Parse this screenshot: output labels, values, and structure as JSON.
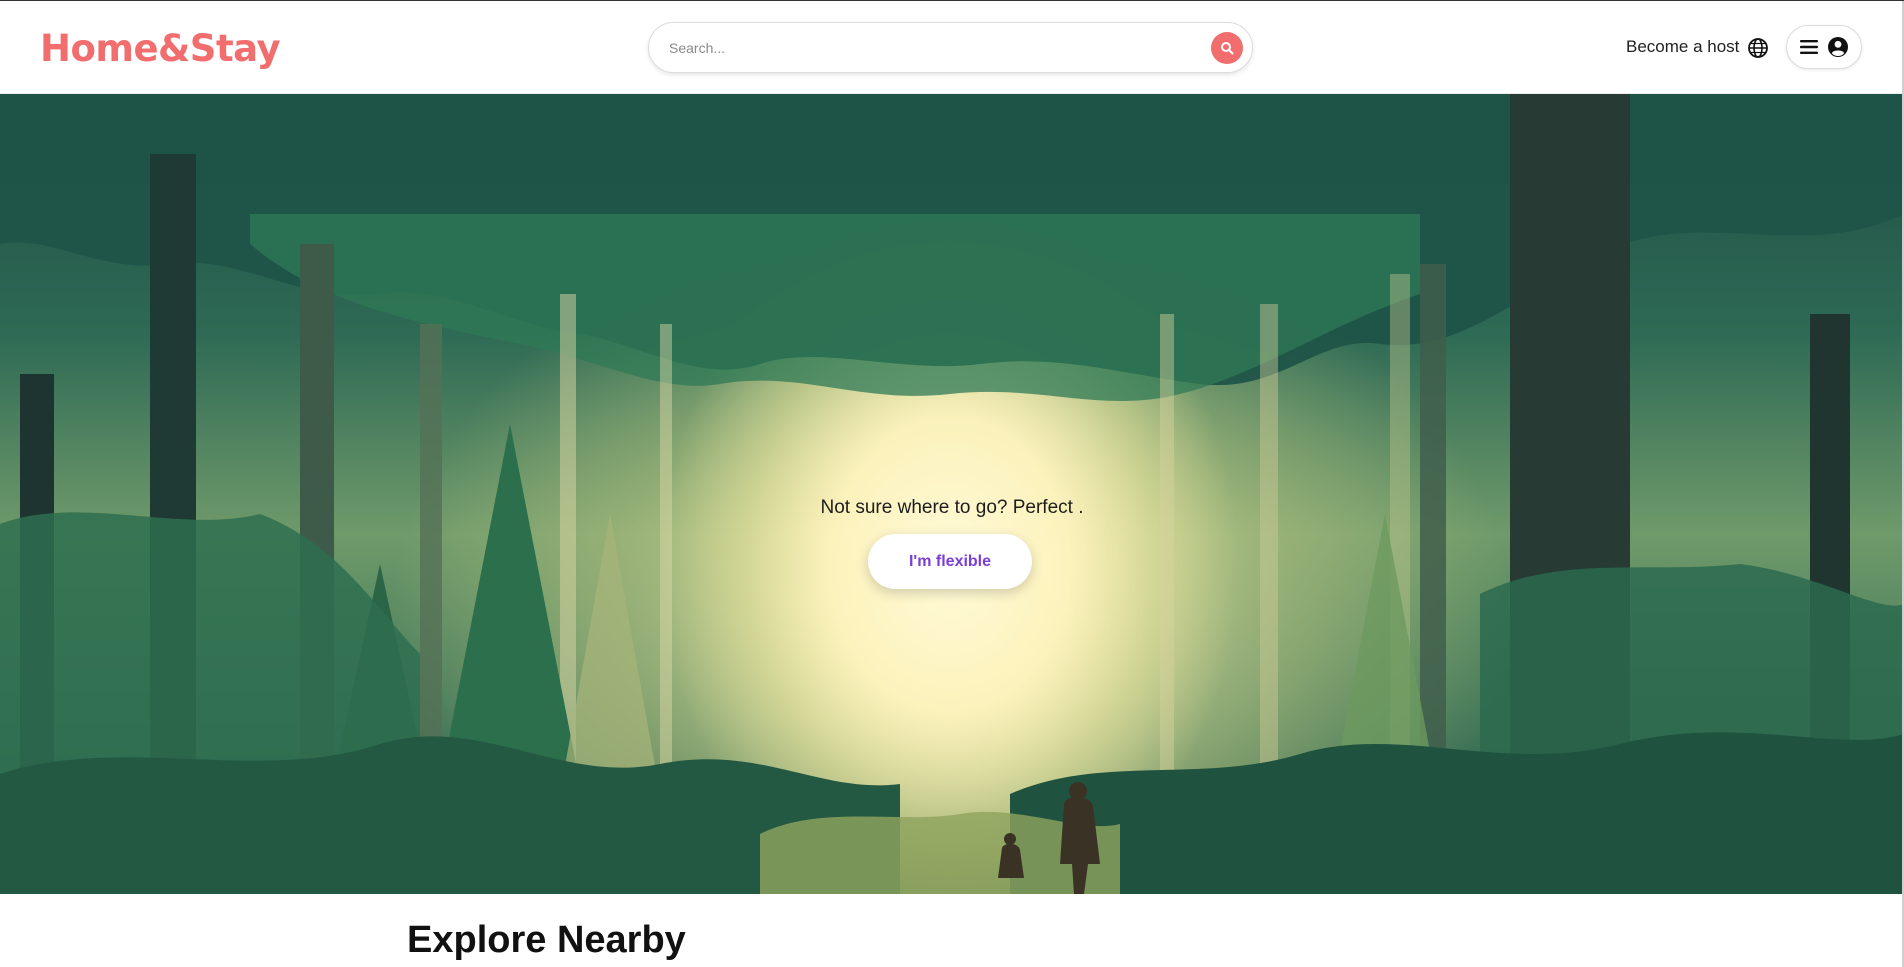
{
  "header": {
    "logo": "Home&Stay",
    "search": {
      "placeholder": "Search..."
    },
    "host_link": "Become a host"
  },
  "hero": {
    "tagline": "Not sure where to go? Perfect .",
    "cta_label": "I'm flexible"
  },
  "main": {
    "section_title": "Explore Nearby"
  },
  "colors": {
    "brand": "#f26d6d",
    "cta_text": "#7a3fd6"
  },
  "icons": [
    "search-icon",
    "globe-icon",
    "hamburger-menu-icon",
    "user-avatar-icon"
  ]
}
